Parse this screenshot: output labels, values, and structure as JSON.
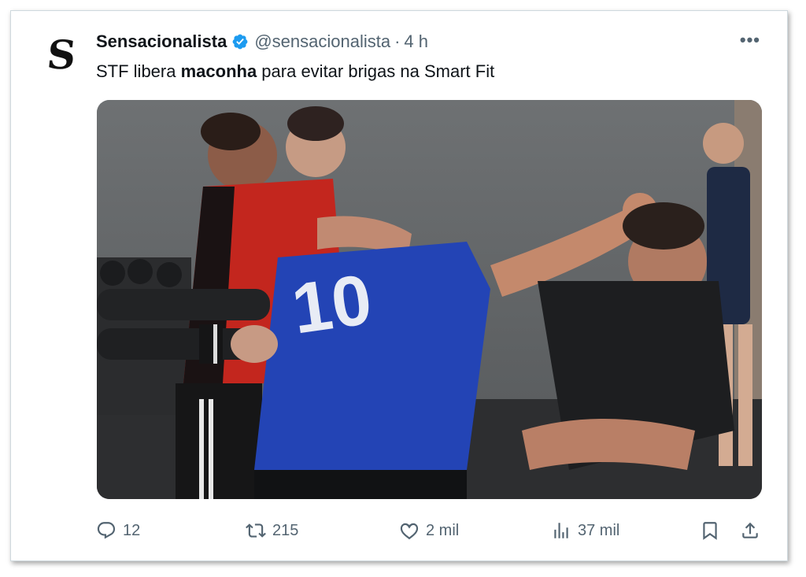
{
  "tweet": {
    "author": {
      "avatar_letter": "S",
      "display_name": "Sensacionalista",
      "verified": true,
      "handle": "@sensacionalista",
      "separator": "·",
      "time": "4 h"
    },
    "text": {
      "before": "STF libera ",
      "bold": "maconha",
      "after": " para evitar brigas na Smart Fit"
    },
    "media": {
      "jersey_number": "10"
    },
    "stats": {
      "replies": "12",
      "retweets": "215",
      "likes": "2 mil",
      "views": "37 mil"
    },
    "icons": {
      "more": "more-horizontal-icon",
      "reply": "reply-icon",
      "retweet": "retweet-icon",
      "like": "heart-icon",
      "views": "views-chart-icon",
      "bookmark": "bookmark-icon",
      "share": "share-icon",
      "verified": "verified-badge-icon"
    },
    "colors": {
      "verified_blue": "#1d9bf0",
      "secondary_text": "#536471",
      "primary_text": "#0f1419"
    }
  }
}
